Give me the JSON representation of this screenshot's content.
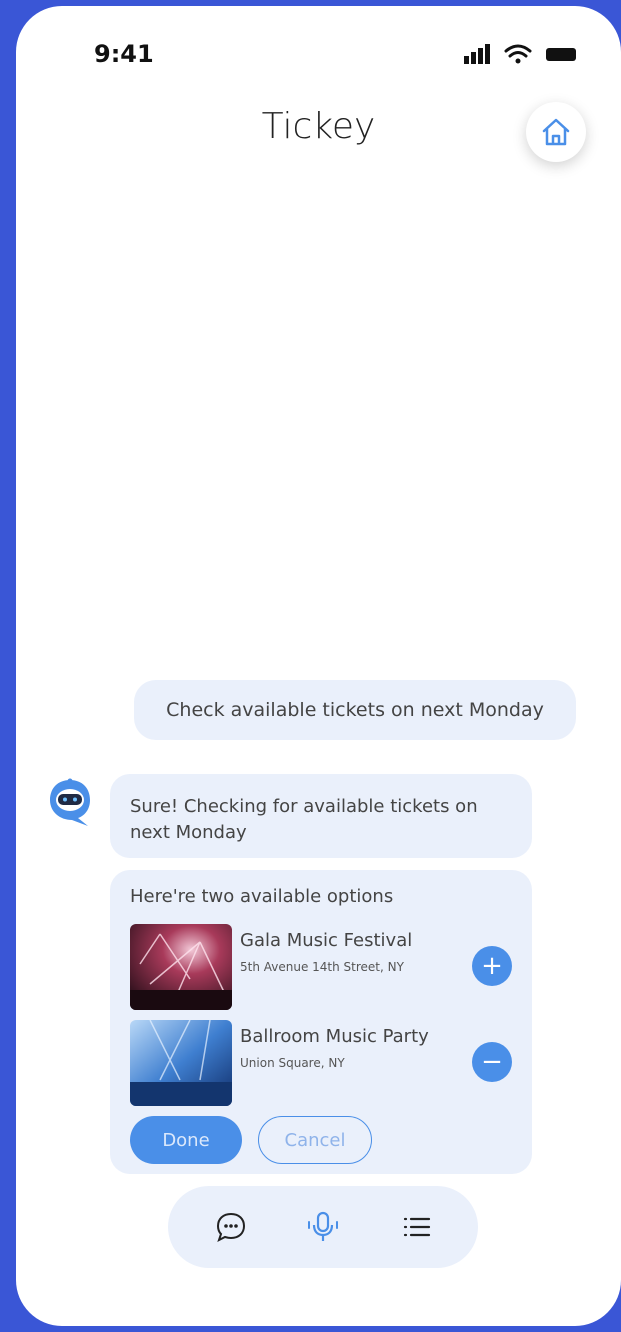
{
  "status_bar": {
    "time": "9:41"
  },
  "header": {
    "title": "Tickey"
  },
  "chat": {
    "user_message": "Check available tickets on next Monday",
    "bot_message": "Sure! Checking for available tickets on next Monday",
    "options_heading": "Here're two available options",
    "options": [
      {
        "name": "Gala Music Festival",
        "address": "5th Avenue 14th Street, NY",
        "action": "+"
      },
      {
        "name": "Ballroom Music Party",
        "address": "Union Square, NY",
        "action": "−"
      }
    ],
    "done_label": "Done",
    "cancel_label": "Cancel"
  },
  "bottom_nav": {
    "icons": [
      "chat-icon",
      "microphone-icon",
      "menu-icon"
    ]
  },
  "colors": {
    "accent": "#4a8fe8",
    "bubble": "#eaf0fb",
    "background": "#3a56d6"
  }
}
